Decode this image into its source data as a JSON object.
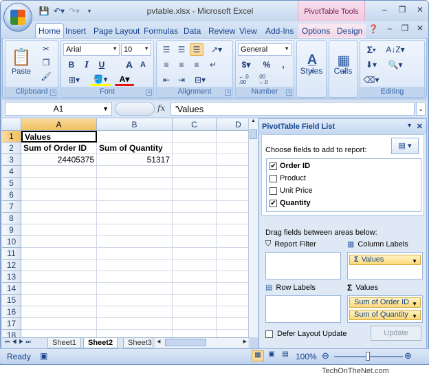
{
  "titlebar": {
    "title": "pvtable.xlsx - Microsoft Excel",
    "context_tab": "PivotTable Tools",
    "minimize": "–",
    "restore": "❐",
    "close": "✕",
    "ribbon_minimize": "–",
    "ribbon_restore": "❐",
    "ribbon_close": "✕"
  },
  "tabs": [
    "Home",
    "Insert",
    "Page Layout",
    "Formulas",
    "Data",
    "Review",
    "View",
    "Add-Ins",
    "Options",
    "Design"
  ],
  "ribbon": {
    "clipboard": {
      "label": "Clipboard",
      "paste": "Paste"
    },
    "font": {
      "label": "Font",
      "name": "Arial",
      "size": "10",
      "bold": "B",
      "italic": "I",
      "underline": "U",
      "grow": "A",
      "shrink": "A",
      "color_a": "A"
    },
    "alignment": {
      "label": "Alignment"
    },
    "number": {
      "label": "Number",
      "format": "General",
      "currency": "$",
      "percent": "%",
      "comma": ",",
      "inc": "←.0 .00",
      "dec": ".00 →.0"
    },
    "styles": {
      "label": "Styles"
    },
    "cells": {
      "label": "Cells"
    },
    "editing": {
      "label": "Editing",
      "sum": "Σ"
    }
  },
  "formula": {
    "namebox": "A1",
    "fx": "fx",
    "content": "'Values"
  },
  "columns": [
    "A",
    "B",
    "C",
    "D"
  ],
  "rows": [
    "1",
    "2",
    "3",
    "4",
    "5",
    "6",
    "7",
    "8",
    "9",
    "10",
    "11",
    "12",
    "13",
    "14",
    "15",
    "16",
    "17",
    "18"
  ],
  "cells": {
    "a1": "Values",
    "a2": "Sum of Order ID",
    "b2": "Sum of Quantity",
    "a3": "24405375",
    "b3": "51317"
  },
  "sheets": [
    "Sheet1",
    "Sheet2",
    "Sheet3"
  ],
  "panel": {
    "title": "PivotTable Field List",
    "choose": "Choose fields to add to report:",
    "fields": [
      {
        "name": "Order ID",
        "checked": "✔"
      },
      {
        "name": "Product",
        "checked": ""
      },
      {
        "name": "Unit Price",
        "checked": ""
      },
      {
        "name": "Quantity",
        "checked": "✔"
      }
    ],
    "drag": "Drag fields between areas below:",
    "report_filter": "Report Filter",
    "column_labels": "Column Labels",
    "column_pill": "Values",
    "sigma": "Σ",
    "row_labels": "Row Labels",
    "values_label": "Values",
    "value_pills": [
      "Sum of Order ID",
      "Sum of Quantity"
    ],
    "defer": "Defer Layout Update",
    "update": "Update"
  },
  "status": {
    "ready": "Ready",
    "zoom": "100%"
  },
  "credit": "TechOnTheNet.com"
}
